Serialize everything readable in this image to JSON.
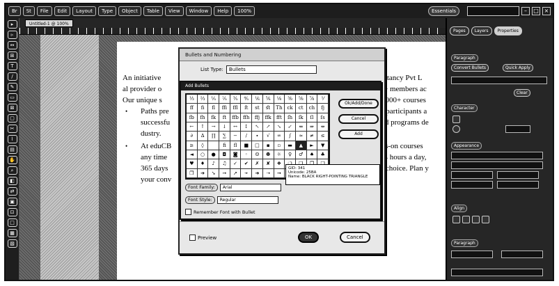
{
  "menubar": {
    "items": [
      "Br",
      "St",
      "File",
      "Edit",
      "Layout",
      "Type",
      "Object",
      "Table",
      "View",
      "Window",
      "Help"
    ],
    "zoom": "100%",
    "workspace": "Essentials",
    "search": ""
  },
  "doc_tab": "Untitled-1 @ 100%",
  "toolbar_tools": [
    "▸",
    "▹",
    "↔",
    "⊞",
    "T",
    "/",
    "✎",
    "▭",
    "⊠",
    "▢",
    "✂",
    "⌇",
    "▤",
    "✋",
    "⌕",
    "◧",
    "⇄",
    "▣",
    "⊡",
    "□",
    "▦",
    "▧"
  ],
  "document": {
    "lines": [
      "An initiative",
      "al provider o",
      "Our unique s",
      "Paths pre",
      "successfu",
      "dustry.",
      "At eduCB",
      "any time",
      "365 days",
      "your conv"
    ],
    "right_fragments": [
      "onsultancy Pvt L",
      "00+ members ac",
      "5000+ courses",
      "p participants a",
      "ed programs de",
      "nds-on courses",
      "24 hours a day,",
      "ur choice. Plan y"
    ]
  },
  "bn_dialog": {
    "title": "Bullets and Numbering",
    "list_type_label": "List Type:",
    "list_type_value": "Bullets",
    "preview_label": "Preview",
    "ok": "OK",
    "cancel": "Cancel"
  },
  "ab_dialog": {
    "title": "Add Bullets",
    "buttons": [
      "Ok/Add/Done",
      "Cancel",
      "Add"
    ],
    "font_family_label": "Font Family:",
    "font_family_value": "Arial",
    "font_style_label": "Font Style:",
    "font_style_value": "Regular",
    "remember_label": "Remember Font with Bullet",
    "glyphs": [
      "⅓",
      "⅔",
      "⅕",
      "⅖",
      "⅗",
      "⅘",
      "⅙",
      "⅚",
      "⅛",
      "⅜",
      "⅝",
      "⅞",
      "⅟",
      "ff",
      "fi",
      "fl",
      "ffi",
      "ffl",
      "ſt",
      "st",
      "ﬆ",
      "Th",
      "ck",
      "ct",
      "ch",
      "fj",
      "fb",
      "fh",
      "fk",
      "ft",
      "ffb",
      "ffh",
      "ffj",
      "ffk",
      "fft",
      "ſh",
      "ſk",
      "ſl",
      "ſs",
      "←",
      "↑",
      "→",
      "↓",
      "↔",
      "↕",
      "↖",
      "↗",
      "↘",
      "↙",
      "⇐",
      "⇒",
      "⇔",
      "∂",
      "∆",
      "∏",
      "∑",
      "−",
      "∕",
      "∙",
      "√",
      "∞",
      "∫",
      "≈",
      "≠",
      "≤",
      "≥",
      "◊",
      "",
      "ﬁ",
      "ﬂ",
      "■",
      "□",
      "▪",
      "▫",
      "▬",
      "▲",
      "►",
      "▼",
      "◄",
      "○",
      "●",
      "◘",
      "◙",
      "◦",
      "☺",
      "☻",
      "☼",
      "♀",
      "♂",
      "♠",
      "♣",
      "♥",
      "♦",
      "♪",
      "♫",
      "✓",
      "✔",
      "✗",
      "✘",
      "❖",
      "❍",
      "❏",
      "❐",
      "❑",
      "❒",
      "➔",
      "➘",
      "➙",
      "➚",
      "➛",
      "➜",
      "➝",
      "➞",
      "➟",
      "➠",
      "➡",
      "➢"
    ],
    "selected_index": 75,
    "tooltip": {
      "line1": "GID: 341",
      "line2": "Unicode: 25BA",
      "line3": "Name: BLACK RIGHT-POINTING TRIANGLE"
    }
  },
  "right_panel": {
    "tabs": [
      "Pages",
      "Layers",
      "Properties"
    ],
    "labels": [
      "Paragraph",
      "Character",
      "Appearance",
      "Align",
      "Paragraph"
    ],
    "buttons": [
      "Convert Bullets",
      "Quick Apply",
      "Clear"
    ]
  }
}
